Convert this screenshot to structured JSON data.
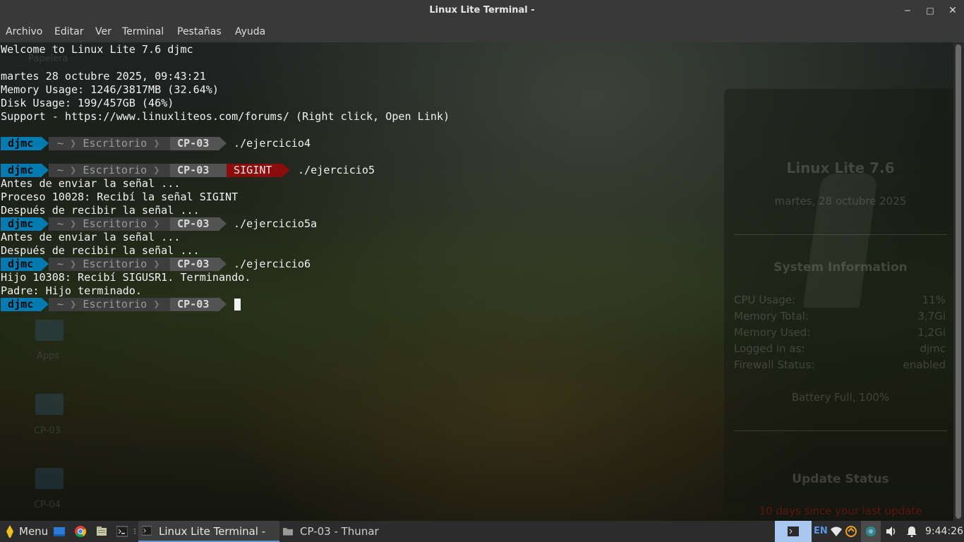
{
  "window": {
    "title": "Linux Lite Terminal -",
    "controls": {
      "minimize": "‒",
      "maximize": "□",
      "close": "✕"
    }
  },
  "menu": [
    "Archivo",
    "Editar",
    "Ver",
    "Terminal",
    "Pestañas",
    "Ayuda"
  ],
  "terminal": {
    "lines": [
      "Welcome to Linux Lite 7.6 djmc",
      "martes 28 octubre 2025, 09:43:21",
      "Memory Usage: 1246/3817MB (32.64%)",
      "Disk Usage: 199/457GB (46%)",
      "Support - https://www.linuxliteos.com/forums/ (Right click, Open Link)"
    ],
    "prompt": {
      "user": "djmc",
      "home": "~",
      "dir1": "Escritorio",
      "dir2": "CP-03",
      "signal": "SIGINT"
    },
    "commands": [
      "./ejercicio4",
      "./ejercicio5",
      "./ejercicio5a",
      "./ejercicio6"
    ],
    "output": [
      "Antes de enviar la señal ...",
      "Proceso 10028: Recibí la señal SIGINT",
      "Después de recibir la señal ...",
      "Antes de enviar la señal ...",
      "Después de recibir la señal ...",
      "Hijo 10308: Recibí SIGUSR1. Terminando.",
      "Padre: Hijo terminado."
    ]
  },
  "desktop": {
    "icons": [
      "Papelera",
      "Apps",
      "CP-03",
      "CP-04"
    ]
  },
  "conky": {
    "title": "Linux Lite 7.6",
    "date": "martes, 28 octubre 2025",
    "sysinfo_header": "System Information",
    "rows": [
      {
        "label": "CPU Usage:",
        "value": "11%"
      },
      {
        "label": "Memory Total:",
        "value": "3,7Gi"
      },
      {
        "label": "Memory Used:",
        "value": "1,2Gi"
      },
      {
        "label": "Logged in as:",
        "value": "djmc"
      },
      {
        "label": "Firewall Status:",
        "value": "enabled"
      }
    ],
    "battery": "Battery Full, 100%",
    "update_header": "Update Status",
    "update_text": "10 days since your last update"
  },
  "taskbar": {
    "menu_label": "Menu",
    "tasks": [
      "Linux Lite Terminal -",
      "CP-03 - Thunar"
    ],
    "language": "EN",
    "clock": "9:44:26"
  }
}
